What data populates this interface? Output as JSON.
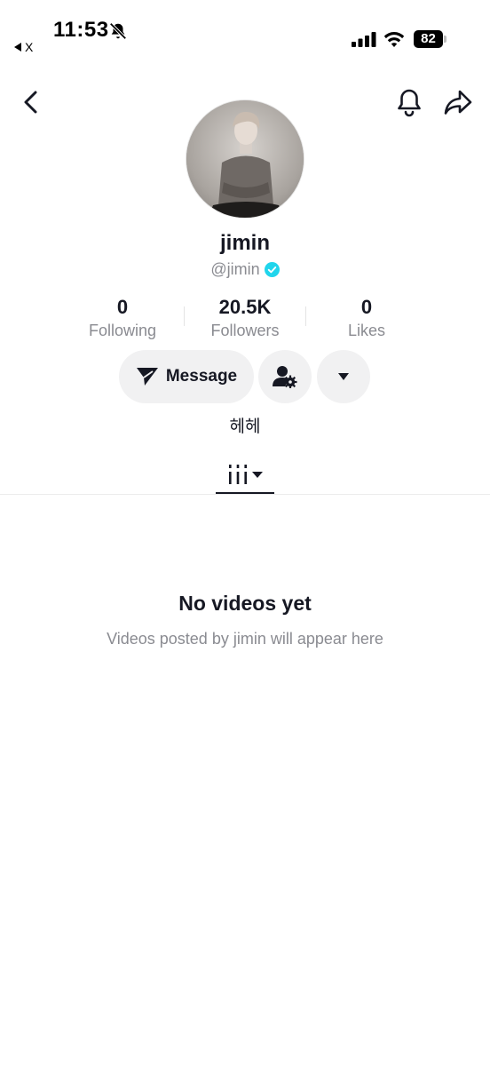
{
  "status_bar": {
    "time": "11:53",
    "back_app": "X",
    "battery": "82"
  },
  "profile": {
    "display_name": "jimin",
    "handle": "@jimin",
    "verified": true,
    "bio": "헤헤"
  },
  "stats": [
    {
      "value": "0",
      "label": "Following"
    },
    {
      "value": "20.5K",
      "label": "Followers"
    },
    {
      "value": "0",
      "label": "Likes"
    }
  ],
  "actions": {
    "message_label": "Message"
  },
  "empty_state": {
    "title": "No videos yet",
    "subtitle": "Videos posted by jimin will appear here"
  },
  "colors": {
    "verified": "#20d5ec",
    "button_bg": "#f1f1f2",
    "muted_text": "#8a8b91",
    "primary_text": "#161823"
  },
  "icons": [
    "back-icon",
    "bell-icon",
    "share-icon",
    "send-icon",
    "friend-settings-icon",
    "caret-down-icon",
    "grid-icon"
  ]
}
